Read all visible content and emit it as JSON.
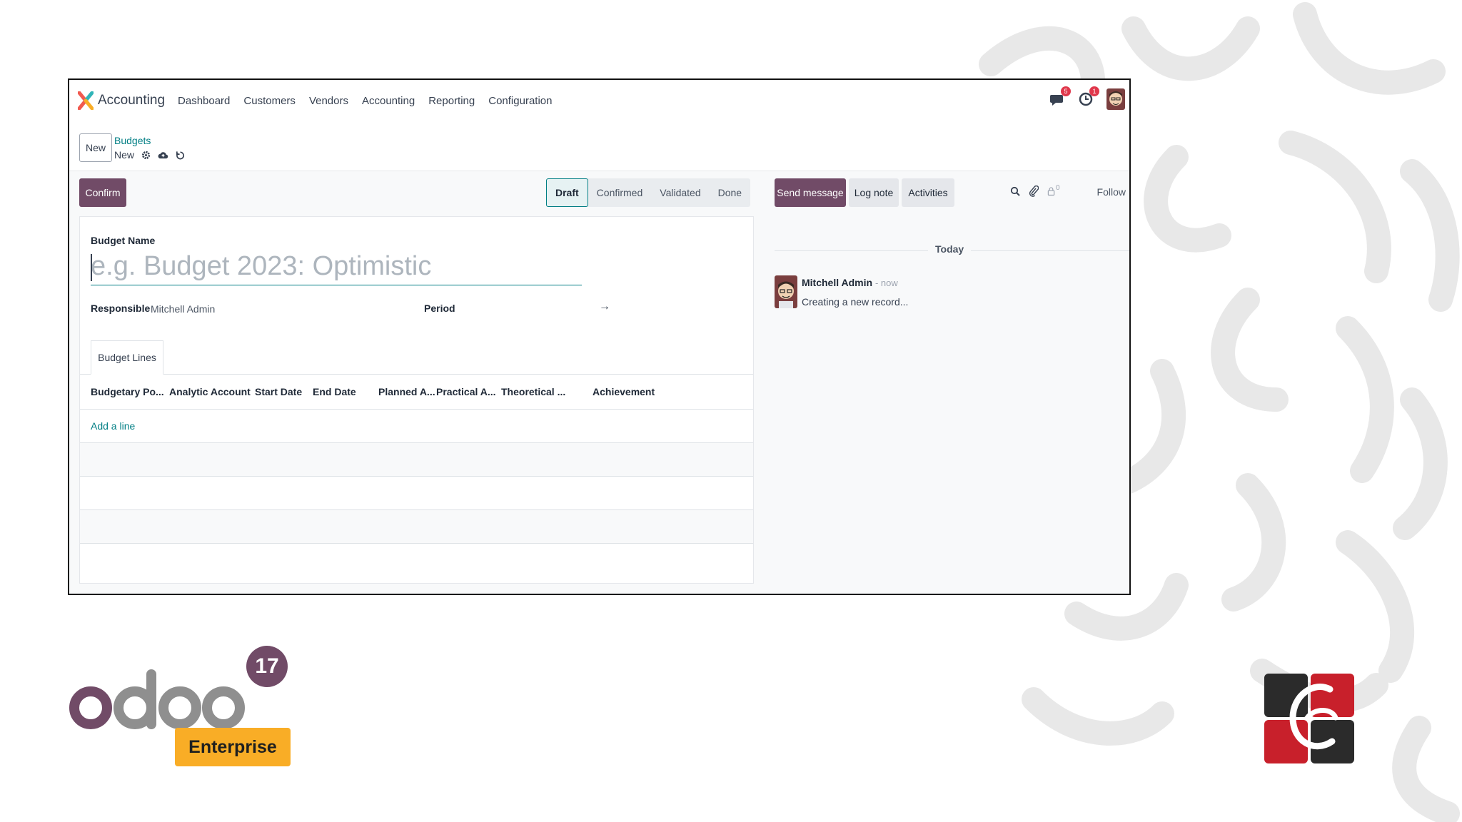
{
  "navbar": {
    "app_title": "Accounting",
    "menu": [
      "Dashboard",
      "Customers",
      "Vendors",
      "Accounting",
      "Reporting",
      "Configuration"
    ],
    "messages_badge": "5",
    "activities_badge": "1"
  },
  "control": {
    "new_label": "New",
    "breadcrumb_parent": "Budgets",
    "breadcrumb_current": "New"
  },
  "actions": {
    "confirm_label": "Confirm"
  },
  "status": {
    "stages": [
      "Draft",
      "Confirmed",
      "Validated",
      "Done"
    ],
    "active": "Draft"
  },
  "form": {
    "budget_name_label": "Budget Name",
    "budget_name_placeholder": "e.g. Budget 2023: Optimistic",
    "responsible_label": "Responsible",
    "responsible_value": "Mitchell Admin",
    "period_label": "Period",
    "period_arrow": "→"
  },
  "tabs": {
    "budget_lines": "Budget Lines"
  },
  "table": {
    "columns": [
      "Budgetary Po...",
      "Analytic Account",
      "Start Date",
      "End Date",
      "Planned A...",
      "Practical A...",
      "Theoretical ...",
      "Achievement"
    ],
    "add_line": "Add a line"
  },
  "chatter": {
    "send_message": "Send message",
    "log_note": "Log note",
    "activities": "Activities",
    "followers_count": "0",
    "follow": "Follow",
    "today": "Today",
    "message_author": "Mitchell Admin",
    "message_time": "- now",
    "message_body": "Creating a new record..."
  },
  "branding": {
    "odoo_word": "odoo",
    "version": "17",
    "edition": "Enterprise"
  },
  "colors": {
    "primary": "#714b67",
    "teal": "#017e84",
    "enterprise": "#f9ad26"
  }
}
